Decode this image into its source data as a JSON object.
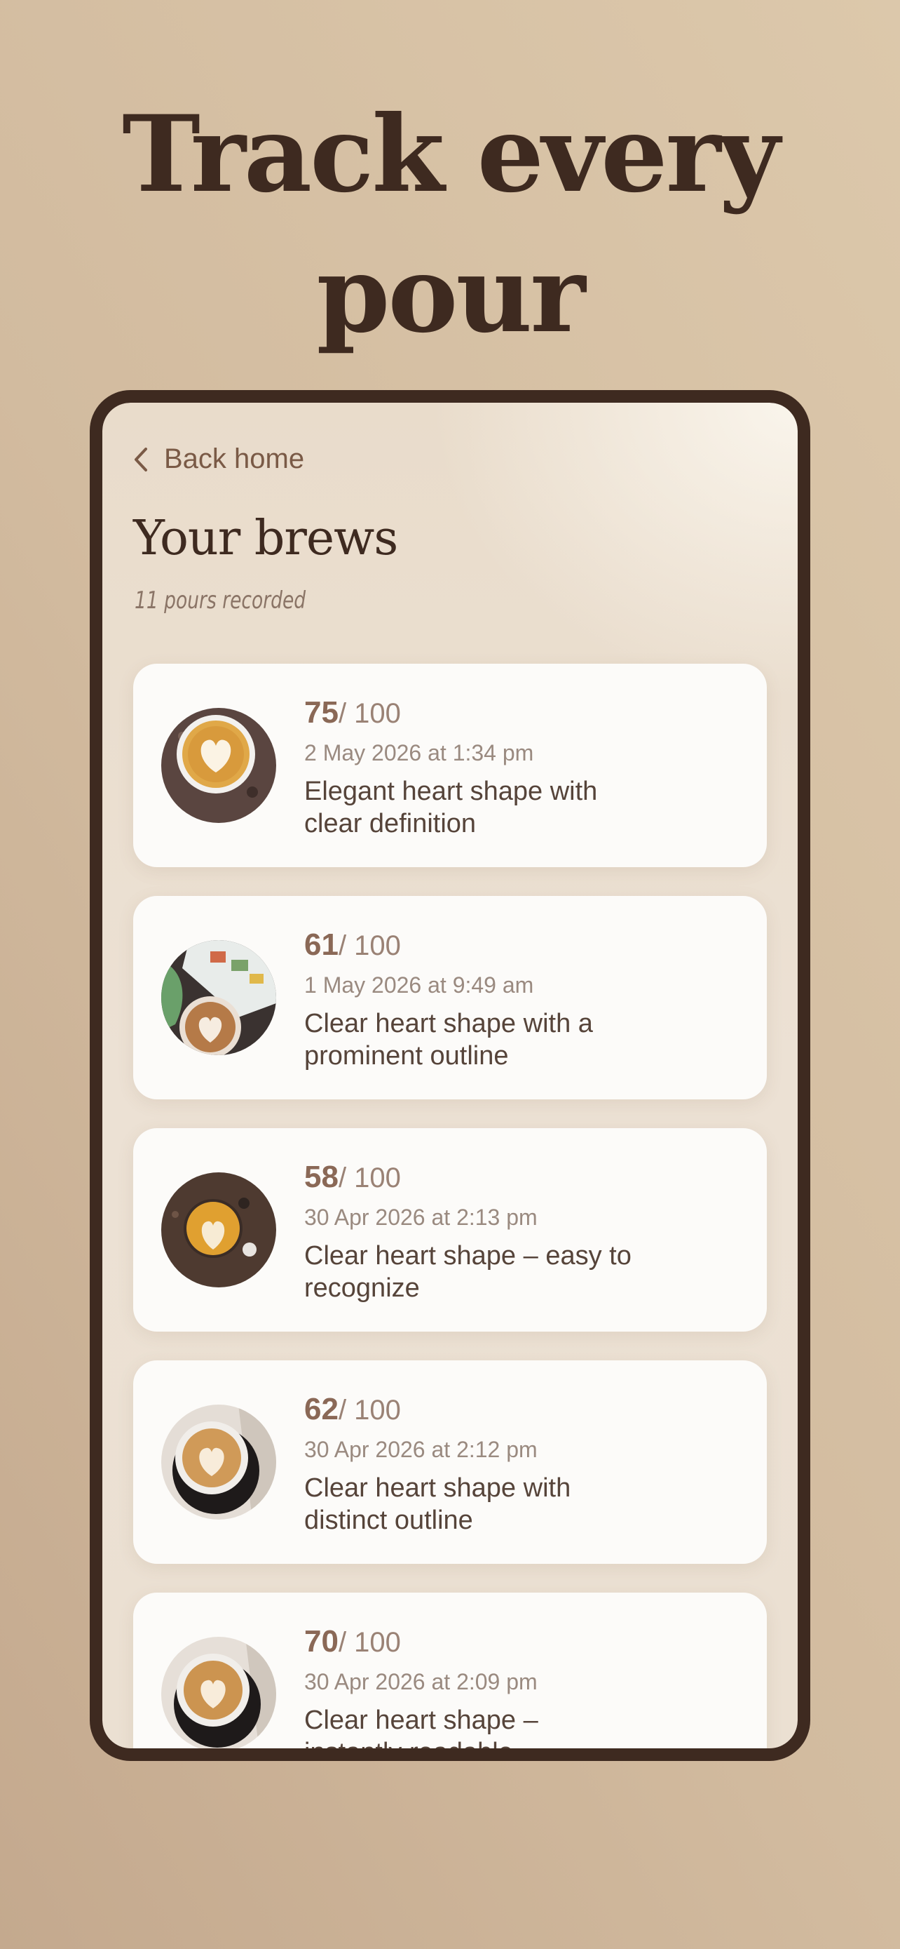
{
  "headline": "Track every pour",
  "screen": {
    "back_label": "Back home",
    "title": "Your brews",
    "subtitle": "11 pours recorded"
  },
  "score_suffix": "/ 100",
  "brews": [
    {
      "score": "75",
      "date": "2 May 2026 at 1:34 pm",
      "description": "Elegant heart shape with clear definition"
    },
    {
      "score": "61",
      "date": "1 May 2026 at 9:49 am",
      "description": "Clear heart shape with a prominent outline"
    },
    {
      "score": "58",
      "date": "30 Apr 2026 at 2:13 pm",
      "description": "Clear heart shape – easy to recognize"
    },
    {
      "score": "62",
      "date": "30 Apr 2026 at 2:12 pm",
      "description": "Clear heart shape with distinct outline"
    },
    {
      "score": "70",
      "date": "30 Apr 2026 at 2:09 pm",
      "description": "Clear heart shape – instantly readable"
    }
  ]
}
